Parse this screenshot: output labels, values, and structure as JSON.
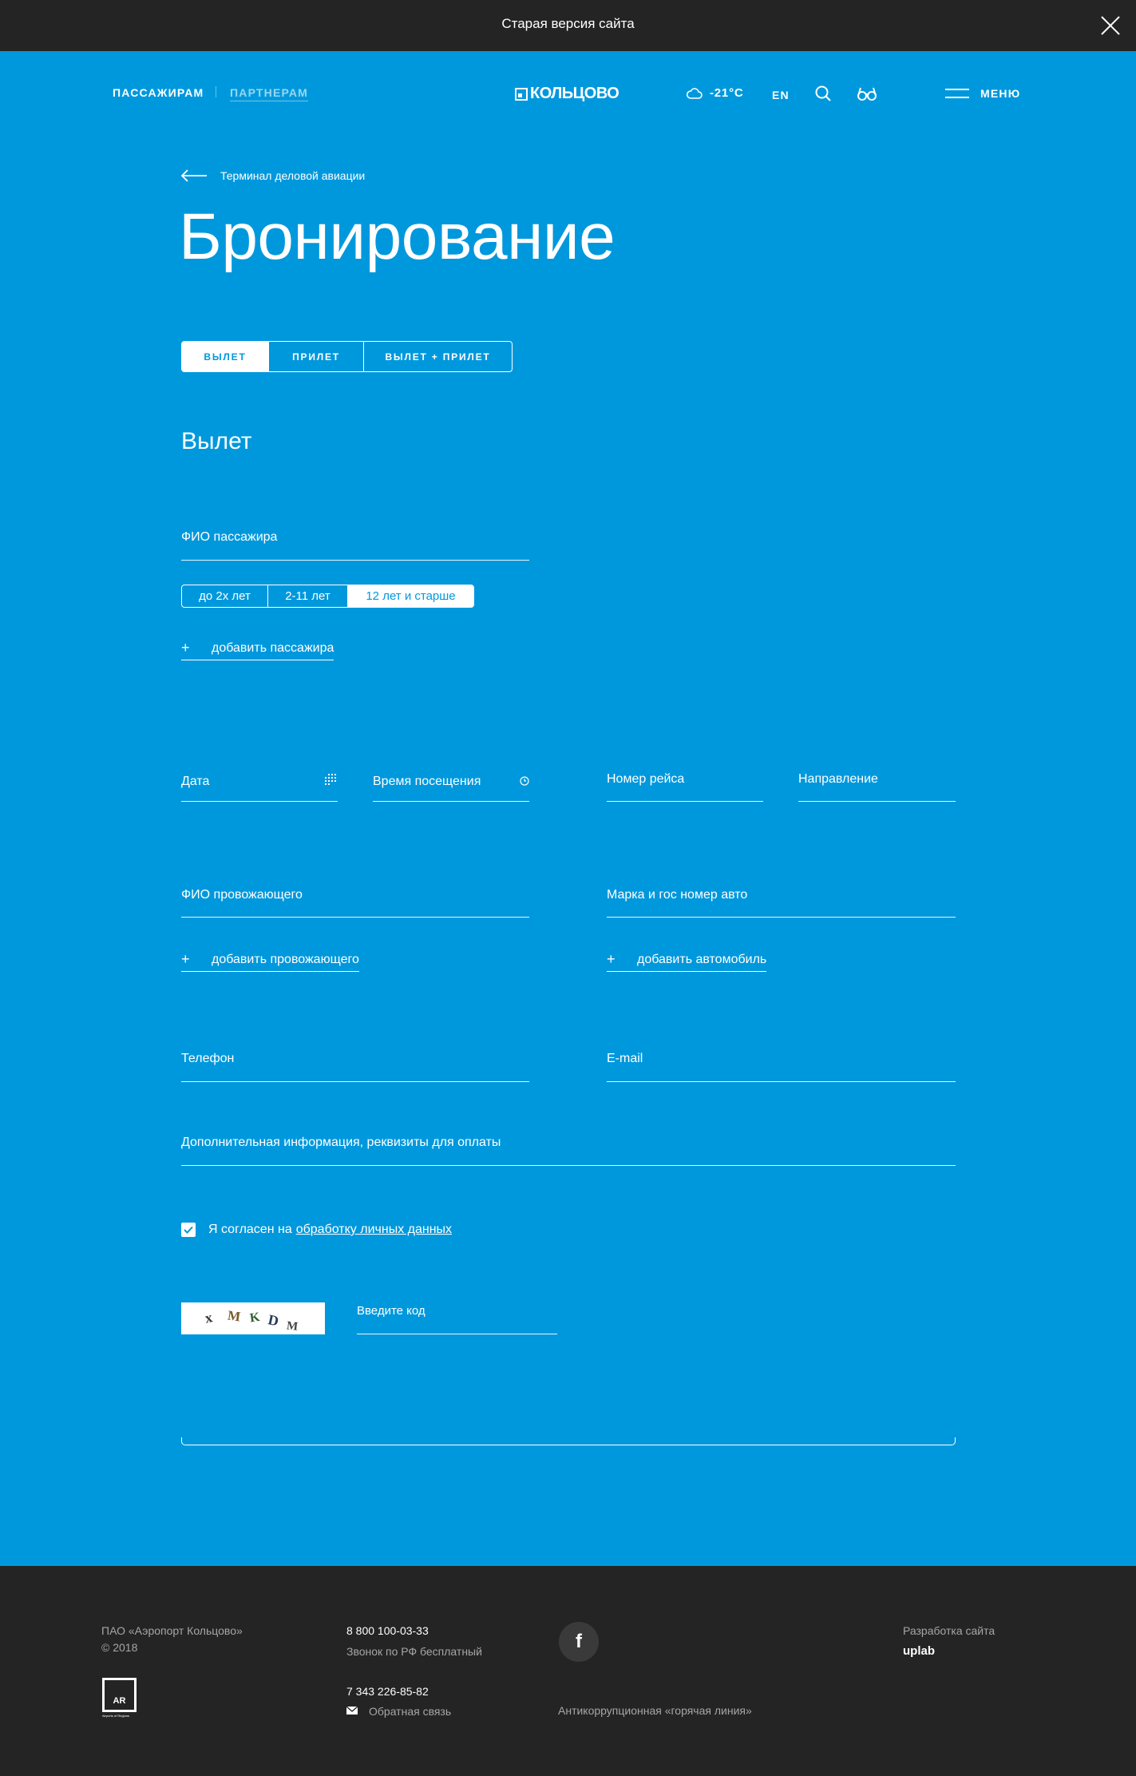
{
  "topbar": {
    "text": "Старая версия сайта"
  },
  "header": {
    "nav_passengers": "ПАССАЖИРАМ",
    "nav_partners": "ПАРТНЕРАМ",
    "logo": "КОЛЬЦОВО",
    "weather": "-21°C",
    "lang": "EN",
    "menu": "МЕНЮ"
  },
  "breadcrumb": {
    "back_label": "Терминал деловой авиации"
  },
  "page": {
    "title": "Бронирование"
  },
  "tabs": [
    {
      "label": "ВЫЛЕТ",
      "active": true
    },
    {
      "label": "ПРИЛЕТ",
      "active": false
    },
    {
      "label": "ВЫЛЕТ + ПРИЛЕТ",
      "active": false
    }
  ],
  "section": {
    "title": "Вылет"
  },
  "form": {
    "passenger_name": "ФИО пассажира",
    "ages": [
      {
        "label": "до 2х лет",
        "active": false
      },
      {
        "label": "2-11 лет",
        "active": false
      },
      {
        "label": "12 лет и старше",
        "active": true
      }
    ],
    "add_passenger": "добавить пассажира",
    "date": "Дата",
    "visit_time": "Время посещения",
    "flight_number": "Номер рейса",
    "direction": "Направление",
    "escort_name": "ФИО провожающего",
    "car": "Марка и гос номер авто",
    "add_escort": "добавить провожающего",
    "add_car": "добавить автомобиль",
    "phone": "Телефон",
    "email": "E-mail",
    "extra_info": "Дополнительная информация, реквизиты для оплаты",
    "consent_text": "Я согласен на",
    "consent_link": "обработку личных данных",
    "consent_checked": true,
    "captcha_code": "x M K D M",
    "captcha_input": "Введите код"
  },
  "footer": {
    "company": "ПАО «Аэропорт Кольцово»",
    "year": "© 2018",
    "ar_logo_text": "AR",
    "ar_caption": "Airports of Regions",
    "phone1": "8 800 100-03-33",
    "phone1_note": "Звонок по РФ бесплатный",
    "phone2": "7 343 226-85-82",
    "feedback": "Обратная связь",
    "facebook": "f",
    "hotline": "Антикоррупционная «горячая линия»",
    "dev_label": "Разработка сайта",
    "dev_name": "uplab"
  },
  "colors": {
    "brand_blue": "#0098dd",
    "dark": "#242424",
    "footer_muted": "#a6a6a6"
  }
}
